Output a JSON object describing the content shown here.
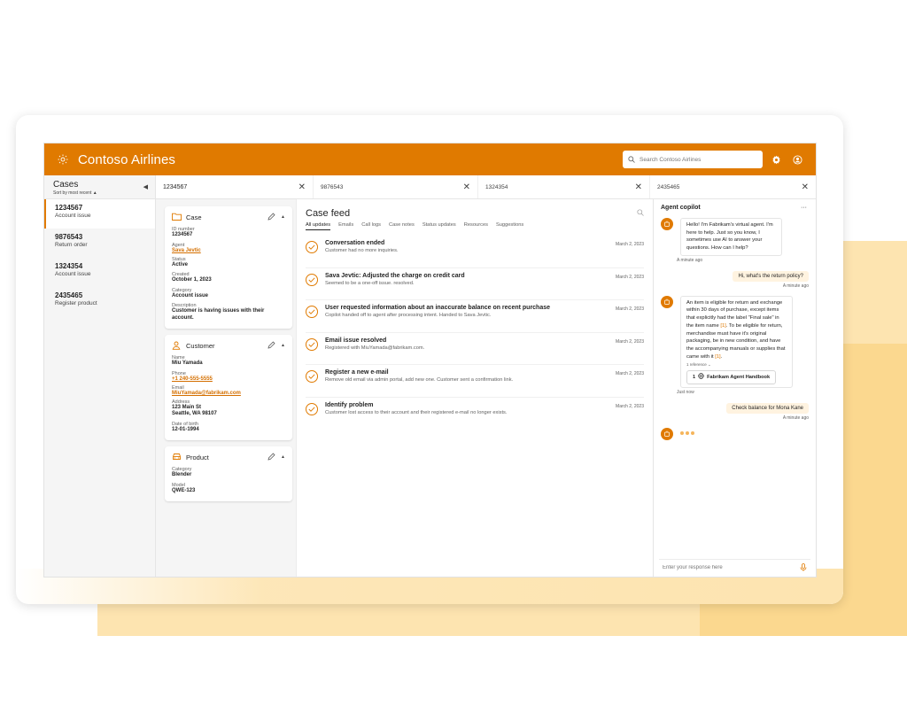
{
  "app": {
    "brand": "Contoso Airlines",
    "search_placeholder": "Search Contoso Airlines"
  },
  "cases_panel": {
    "title": "Cases",
    "sort_label": "Sort by most recent",
    "items": [
      {
        "id": "1234567",
        "type": "Account issue"
      },
      {
        "id": "9876543",
        "type": "Return order"
      },
      {
        "id": "1324354",
        "type": "Account issue"
      },
      {
        "id": "2435465",
        "type": "Register product"
      }
    ]
  },
  "tabs": [
    {
      "label": "1234567"
    },
    {
      "label": "9876543"
    },
    {
      "label": "1324354"
    },
    {
      "label": "2435465"
    }
  ],
  "case_card": {
    "title": "Case",
    "id_label": "ID number",
    "id_value": "1234567",
    "agent_label": "Agent",
    "agent_value": "Sava Jevtic",
    "status_label": "Status",
    "status_value": "Active",
    "created_label": "Created",
    "created_value": "October 1, 2023",
    "category_label": "Category",
    "category_value": "Account issue",
    "description_label": "Description",
    "description_value": "Customer is having issues with their account."
  },
  "customer_card": {
    "title": "Customer",
    "name_label": "Name",
    "name_value": "Miu Yamada",
    "phone_label": "Phone",
    "phone_value": "+1 240-555-5555",
    "email_label": "Email",
    "email_value": "MiuYamada@fabrikam.com",
    "address_label": "Address",
    "address_line1": "123 Main St",
    "address_line2": "Seattle, WA 98107",
    "dob_label": "Date of birth",
    "dob_value": "12-01-1994"
  },
  "product_card": {
    "title": "Product",
    "category_label": "Category",
    "category_value": "Blender",
    "model_label": "Model",
    "model_value": "QWE-123"
  },
  "feed": {
    "title": "Case feed",
    "tabs": [
      "All updates",
      "Emails",
      "Call logs",
      "Case notes",
      "Status updates",
      "Resources",
      "Suggestions"
    ],
    "items": [
      {
        "title": "Conversation ended",
        "desc": "Customer had no more inquiries.",
        "date": "March 2, 2023"
      },
      {
        "title": "Sava Jevtic: Adjusted the charge on credit card",
        "desc": "Seemed to be a one-off issue. resolved.",
        "date": "March 2, 2023"
      },
      {
        "title": "User requested information about an inaccurate balance on recent purchase",
        "desc": "Copilot handed off to agent after processing intent. Handed to Sava Jevtic.",
        "date": "March 2, 2023"
      },
      {
        "title": "Email issue resolved",
        "desc": "Registered with MiuYamada@fabrikam.com.",
        "date": "March 2, 2023"
      },
      {
        "title": "Register a new e-mail",
        "desc": "Remove old email via admin portal, add new one. Customer sent a confirmation link.",
        "date": "March 2, 2023"
      },
      {
        "title": "Identify problem",
        "desc": "Customer lost access to their account and their registered e-mail no longer exists.",
        "date": "March 2, 2023"
      }
    ]
  },
  "copilot": {
    "title": "Agent copilot",
    "more": "···",
    "msg1": "Hello! I'm Fabrikam's virtual agent. I'm here to help. Just so you know, I sometimes use AI to answer your questions. How can I help?",
    "msg1_time": "A minute ago",
    "user1": "Hi, what's the return policy?",
    "user1_time": "A minute ago",
    "msg2_a": "An item is eligible for return and exchange within 30 days of purchase, except items that explicitly had the label \"Final sale\" in the item name ",
    "msg2_ref1": "[1]",
    "msg2_b": ". To be eligible for return, merchandise must have it's original packaging, be in new condition, and have the accompanying manuals or supplies that came with it ",
    "msg2_ref2": "[1]",
    "msg2_c": ".",
    "reference_count": "1 reference",
    "reference_num": "1",
    "reference_title": "Fabrikam Agent Handbook",
    "msg2_time": "Just now",
    "user2": "Check balance for Mona Kane",
    "user2_time": "A minute ago",
    "input_placeholder": "Enter your response here"
  },
  "colors": {
    "brand": "#e07a00",
    "accent_light": "#fde4b0"
  }
}
